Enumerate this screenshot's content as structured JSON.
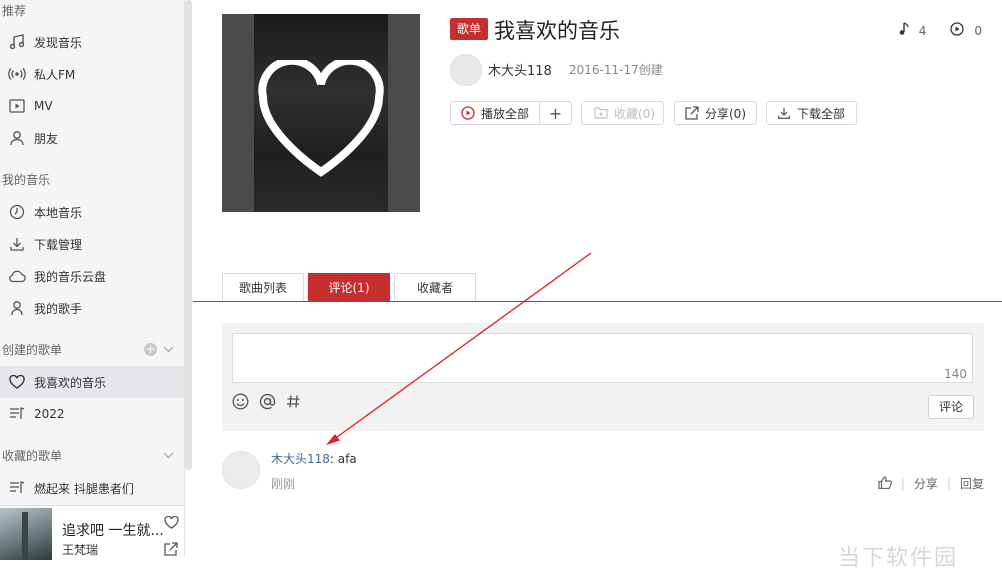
{
  "sidebar": {
    "recommend_header": "推荐",
    "recommend_items": [
      {
        "label": "发现音乐",
        "icon": "music-note-icon"
      },
      {
        "label": "私人FM",
        "icon": "radio-icon"
      },
      {
        "label": "MV",
        "icon": "video-icon"
      },
      {
        "label": "朋友",
        "icon": "friends-icon"
      }
    ],
    "my_music_header": "我的音乐",
    "my_music_items": [
      {
        "label": "本地音乐",
        "icon": "clock-icon"
      },
      {
        "label": "下载管理",
        "icon": "download-icon"
      },
      {
        "label": "我的音乐云盘",
        "icon": "cloud-icon"
      },
      {
        "label": "我的歌手",
        "icon": "singer-icon"
      }
    ],
    "created_header": "创建的歌单",
    "created_items": [
      {
        "label": "我喜欢的音乐",
        "icon": "heart-icon",
        "active": true
      },
      {
        "label": "2022",
        "icon": "playlist-icon"
      }
    ],
    "collected_header": "收藏的歌单",
    "collected_items": [
      {
        "label": "燃起来 抖腿患者们",
        "icon": "playlist-icon"
      }
    ]
  },
  "now_playing": {
    "title": "追求吧 一生就...",
    "artist": "王梵瑞"
  },
  "playlist": {
    "badge": "歌单",
    "title": "我喜欢的音乐",
    "track_count": "4",
    "play_count": "0",
    "creator": "木大头118",
    "created_date": "2016-11-17创建",
    "buttons": {
      "play_all": "播放全部",
      "add": "+",
      "collect": "收藏(0)",
      "share": "分享(0)",
      "download_all": "下载全部"
    }
  },
  "tabs": [
    {
      "label": "歌曲列表"
    },
    {
      "label": "评论(1)",
      "active": true
    },
    {
      "label": "收藏者"
    }
  ],
  "comment_box": {
    "remaining_chars": "140",
    "submit_label": "评论",
    "tools": [
      "emoji-icon",
      "at-icon",
      "hashtag-icon"
    ]
  },
  "comments": [
    {
      "user": "木大头118",
      "separator": ": ",
      "text": "afa",
      "time": "刚刚",
      "actions": {
        "share": "分享",
        "reply": "回复"
      }
    }
  ],
  "watermark": "当下软件园",
  "colors": {
    "accent": "#c62f2f",
    "link": "#3f6b9a",
    "annotation_arrow": "#e02020"
  }
}
